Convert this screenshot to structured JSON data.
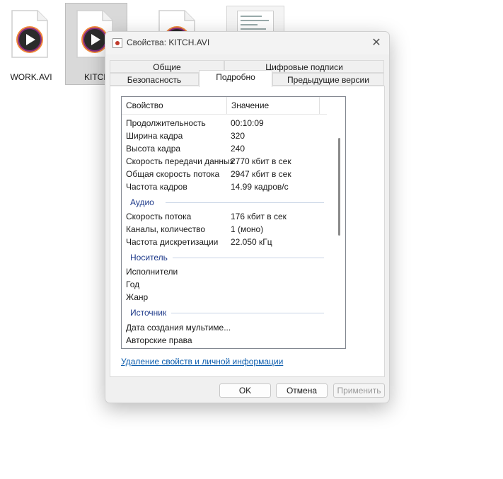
{
  "desktop": {
    "files": [
      {
        "name": "WORK.AVI",
        "icon": "media-file-icon"
      },
      {
        "name": "KITCH",
        "icon": "media-file-icon"
      },
      {
        "name": "",
        "icon": "media-file-icon"
      }
    ]
  },
  "dialog": {
    "title": "Свойства: KITCH.AVI",
    "tabs_top": [
      "Общие",
      "Цифровые подписи"
    ],
    "tabs_bottom": [
      "Безопасность",
      "Подробно",
      "Предыдущие версии"
    ],
    "active_tab": "Подробно",
    "list": {
      "headers": {
        "property": "Свойство",
        "value": "Значение"
      },
      "video_rows": [
        {
          "k": "Продолжительность",
          "v": "00:10:09"
        },
        {
          "k": "Ширина кадра",
          "v": "320"
        },
        {
          "k": "Высота кадра",
          "v": "240"
        },
        {
          "k": "Скорость передачи данных",
          "v": "2770 кбит в сек"
        },
        {
          "k": "Общая скорость потока",
          "v": "2947 кбит в сек"
        },
        {
          "k": "Частота кадров",
          "v": "14.99 кадров/с"
        }
      ],
      "audio_group": "Аудио",
      "audio_rows": [
        {
          "k": "Скорость потока",
          "v": "176 кбит в сек"
        },
        {
          "k": "Каналы, количество",
          "v": "1 (моно)"
        },
        {
          "k": "Частота дискретизации",
          "v": "22.050 кГц"
        }
      ],
      "media_group": "Носитель",
      "media_rows": [
        {
          "k": "Исполнители",
          "v": ""
        },
        {
          "k": "Год",
          "v": ""
        },
        {
          "k": "Жанр",
          "v": ""
        }
      ],
      "source_group": "Источник",
      "source_rows": [
        {
          "k": "Дата создания мультиме...",
          "v": ""
        },
        {
          "k": "Авторские права",
          "v": ""
        }
      ]
    },
    "remove_link": "Удаление свойств и личной информации",
    "buttons": {
      "ok": "OK",
      "cancel": "Отмена",
      "apply": "Применить"
    }
  },
  "colors": {
    "group_heading": "#1e3a8a",
    "link": "#0b5cad",
    "selection": "#d9d9d9"
  }
}
